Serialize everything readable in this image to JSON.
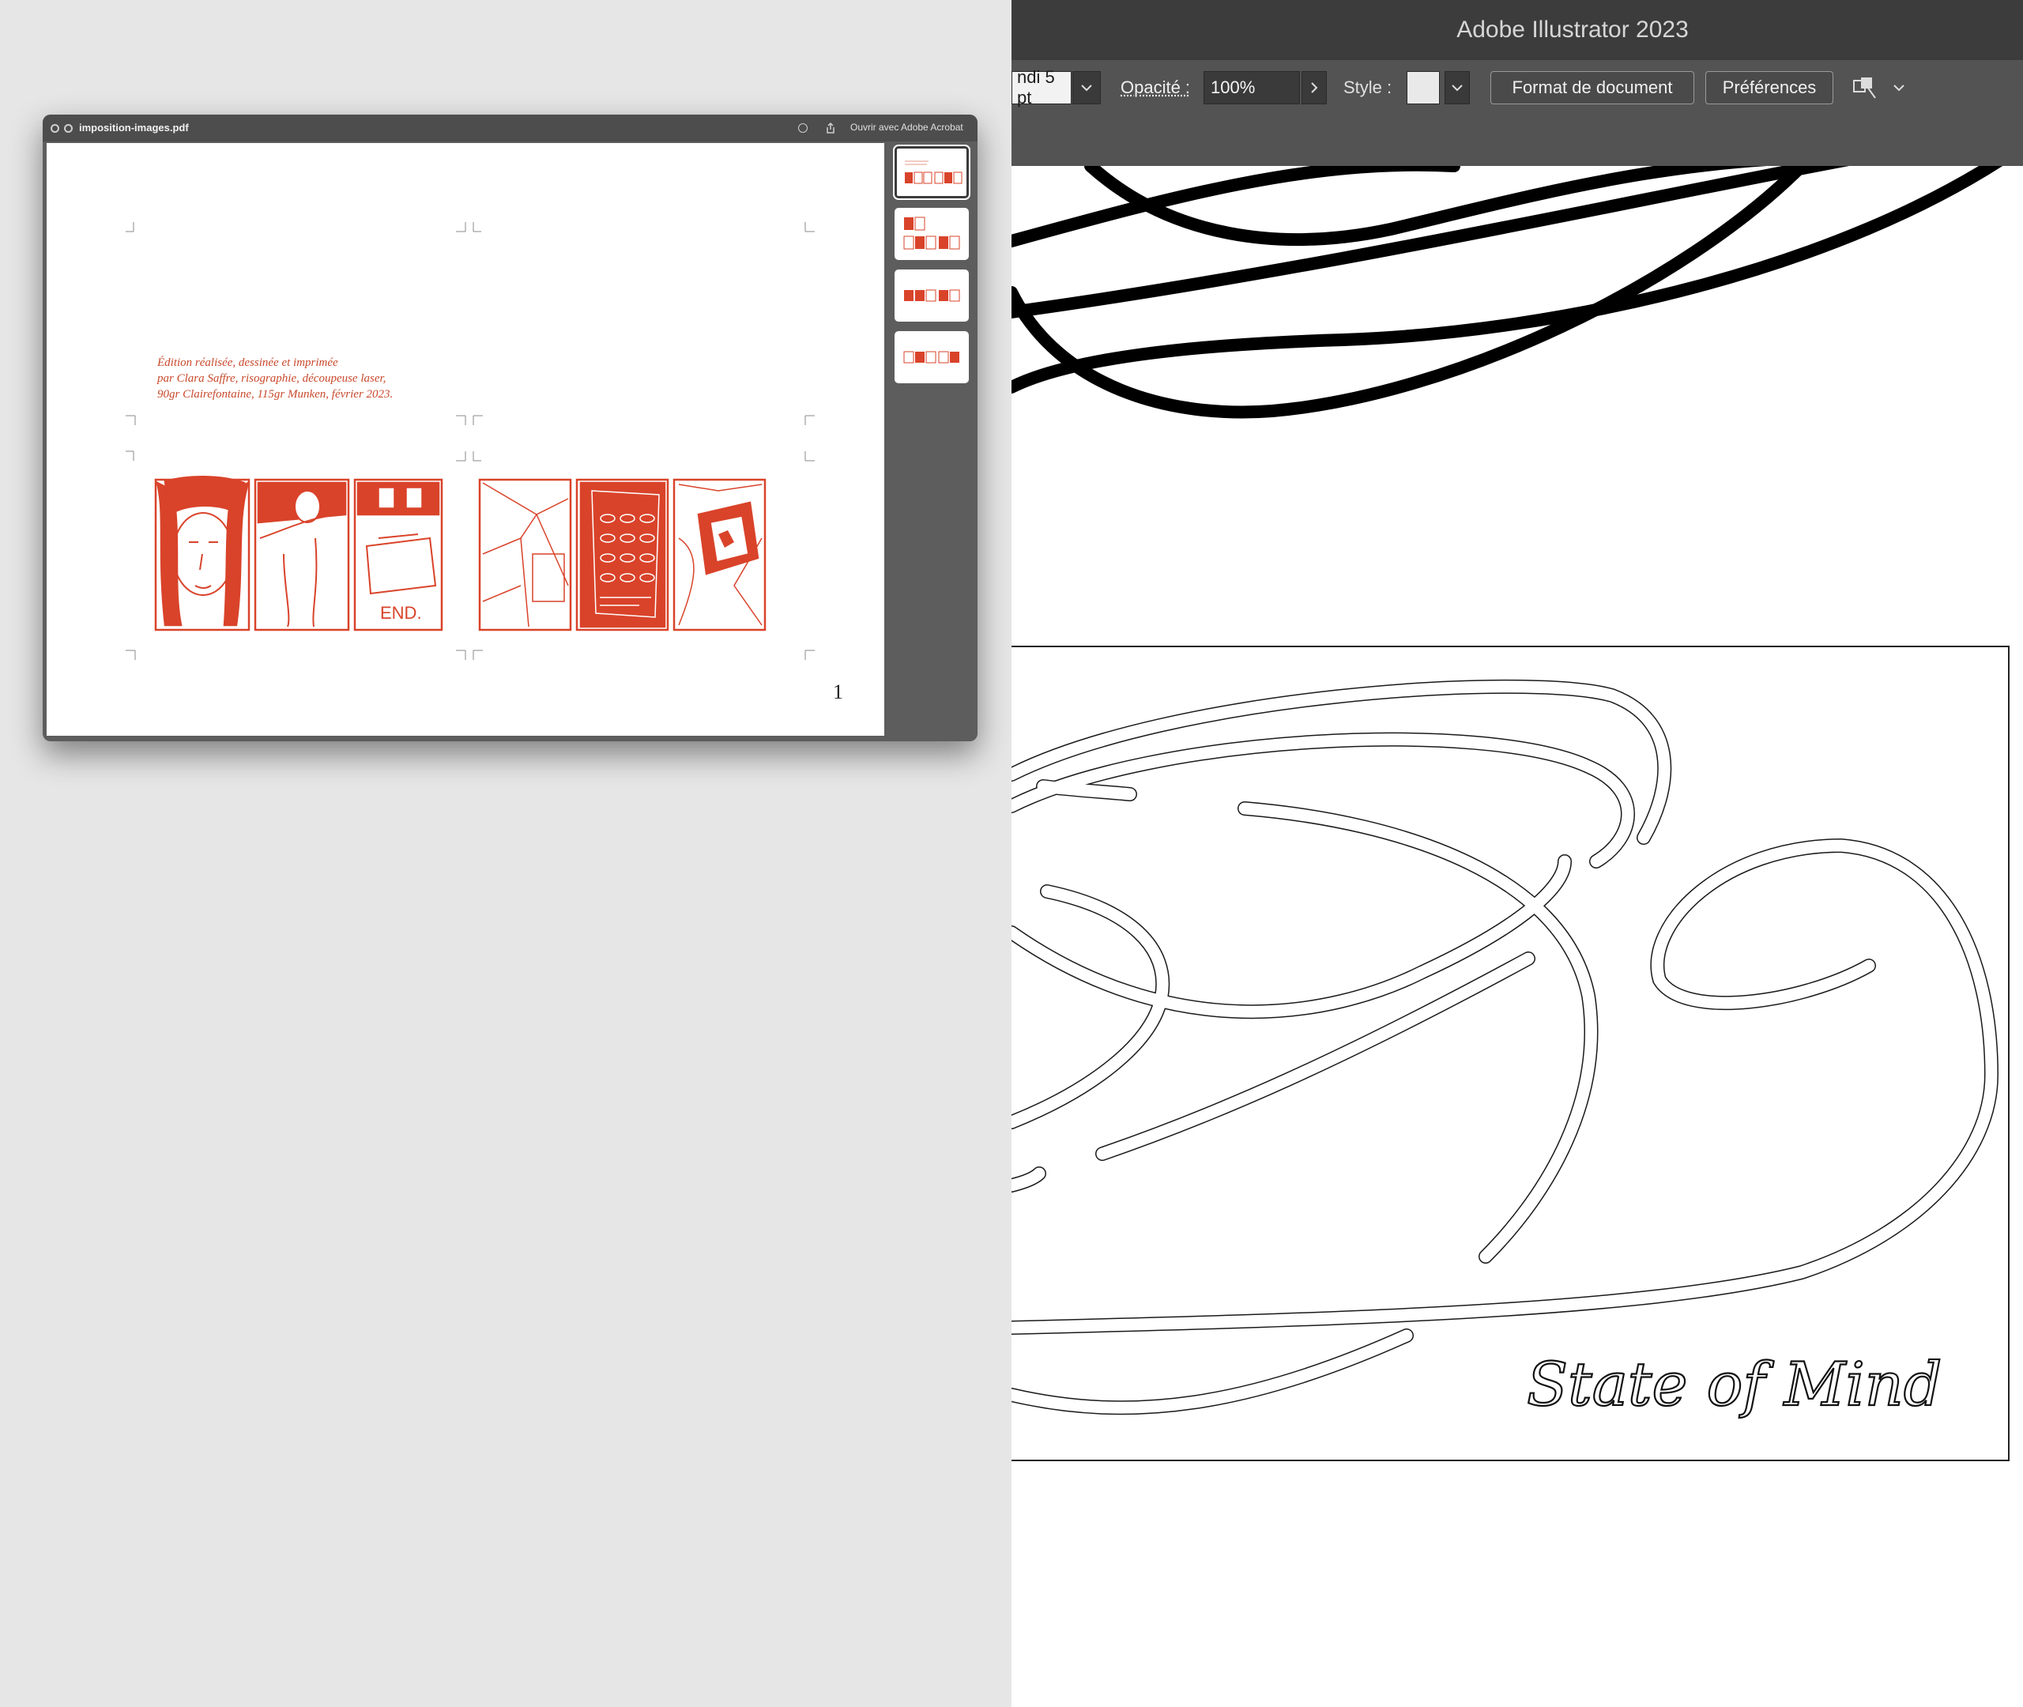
{
  "illustrator": {
    "window_title": "Adobe Illustrator 2023",
    "control_bar": {
      "stroke_value": "ndi 5 pt",
      "opacity_label": "Opacité :",
      "opacity_value": "100%",
      "style_label": "Style :",
      "document_format_button": "Format de document",
      "preferences_button": "Préférences"
    },
    "artboard": {
      "title_text": "State of Mind"
    }
  },
  "preview": {
    "filename": "imposition-images.pdf",
    "open_button": "Ouvrir avec Adobe Acrobat",
    "page": {
      "colophon_lines": [
        "Édition réalisée, dessinée et imprimée",
        "par Clara Saffre, risographie, découpeuse laser,",
        "90gr Clairefontaine, 115gr Munken, février 2023."
      ],
      "panel_text_end": "END.",
      "page_number": "1"
    },
    "thumbnail_count": 4,
    "selected_thumbnail": 1
  },
  "colors": {
    "accent_red": "#d9432a",
    "illustrator_chrome": "#535353",
    "illustrator_titlebar": "#3c3c3c"
  },
  "icons": {
    "close": "close-icon",
    "minimize": "minimize-icon",
    "info": "info-icon",
    "share": "share-icon",
    "arrange": "arrange-documents-icon",
    "chevron": "chevron-down-icon"
  }
}
